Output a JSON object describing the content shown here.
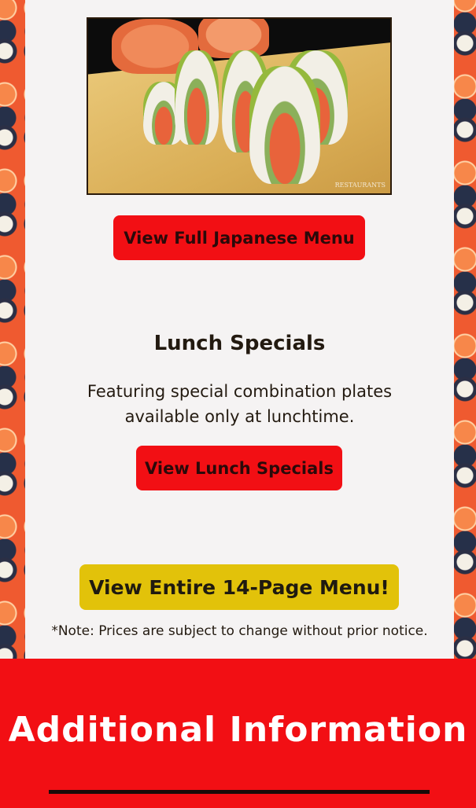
{
  "hero": {
    "watermark": "RESTAURANTS"
  },
  "buttons": {
    "japanese_menu": "View Full Japanese Menu",
    "lunch_specials": "View Lunch Specials",
    "entire_menu": "View Entire 14-Page Menu!"
  },
  "lunch": {
    "title": "Lunch Specials",
    "description": "Featuring special combination plates available only at lunchtime."
  },
  "note": "*Note: Prices are subject to change without prior notice.",
  "footer": {
    "title": "Additional Information"
  },
  "colors": {
    "button_red": "#f20f14",
    "button_gold": "#e2c20a",
    "panel_bg": "#f5f3f3",
    "footer_bg": "#f20f14"
  }
}
